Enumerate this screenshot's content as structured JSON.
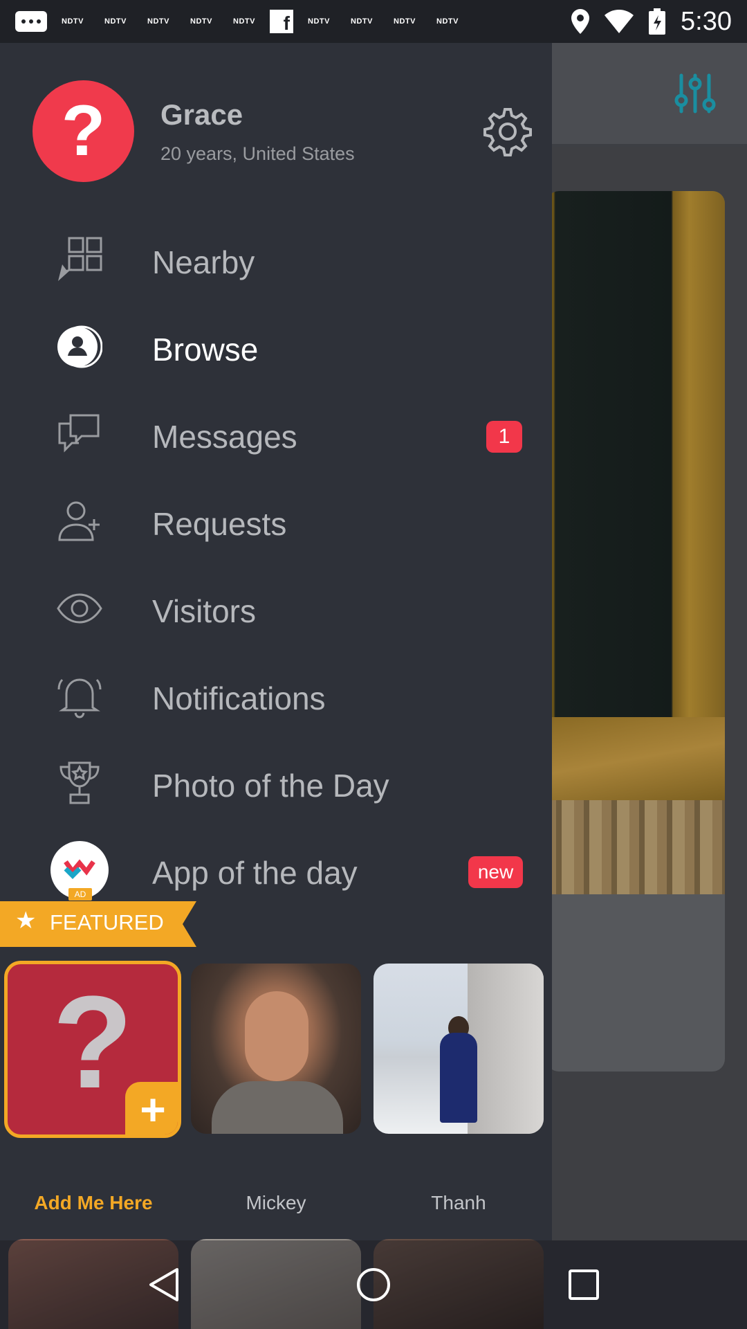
{
  "status_bar": {
    "notification_labels": [
      "NDTV",
      "NDTV",
      "NDTV",
      "NDTV",
      "NDTV",
      "NDTV",
      "NDTV",
      "NDTV",
      "NDTV",
      "NDTV"
    ],
    "time": "5:30",
    "icons": [
      "chat-icon",
      "facebook-icon",
      "location-icon",
      "wifi-icon",
      "battery-icon"
    ]
  },
  "profile": {
    "avatar_glyph": "?",
    "name": "Grace",
    "subtitle": "20 years, United States"
  },
  "menu": {
    "items": [
      {
        "label": "Nearby",
        "icon": "nearby-icon"
      },
      {
        "label": "Browse",
        "icon": "browse-icon",
        "active": true
      },
      {
        "label": "Messages",
        "icon": "messages-icon",
        "badge": "1"
      },
      {
        "label": "Requests",
        "icon": "requests-icon"
      },
      {
        "label": "Visitors",
        "icon": "visitors-icon"
      },
      {
        "label": "Notifications",
        "icon": "notifications-icon"
      },
      {
        "label": "Photo of the Day",
        "icon": "trophy-icon"
      },
      {
        "label": "App of the day",
        "icon": "app-of-the-day-icon",
        "badge": "new",
        "ad_tag": "AD"
      }
    ]
  },
  "featured": {
    "title": "FEATURED",
    "tiles": [
      {
        "label": "Add Me Here",
        "glyph": "?",
        "plus": "+"
      },
      {
        "label": "Mickey"
      },
      {
        "label": "Thanh"
      }
    ]
  },
  "colors": {
    "drawer_bg": "#2e3139",
    "accent_red": "#f2374a",
    "featured_orange": "#f3a825",
    "filter_teal": "#1a8ea0"
  },
  "nav": {
    "buttons": [
      "back-icon",
      "home-icon",
      "recents-icon"
    ]
  }
}
